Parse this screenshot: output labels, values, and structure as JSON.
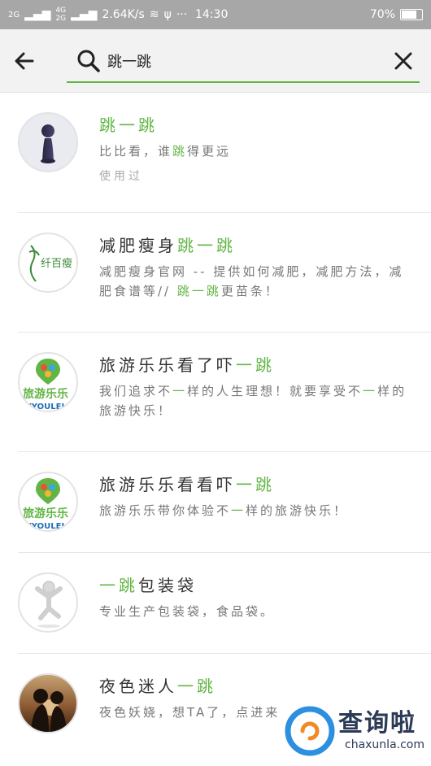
{
  "status_bar": {
    "signal1": "2G",
    "signal2": "4G",
    "signal2b": "2G",
    "speed": "2.64K/s",
    "time": "14:30",
    "battery_percent": "70%"
  },
  "search": {
    "query_prefix": "",
    "query": "跳一跳"
  },
  "results": [
    {
      "title_parts": [
        {
          "t": "跳一跳",
          "hl": true
        }
      ],
      "desc_parts": [
        {
          "t": "比比看，谁",
          "hl": false
        },
        {
          "t": "跳",
          "hl": true
        },
        {
          "t": "得更远",
          "hl": false
        }
      ],
      "meta": "使用过",
      "avatar": "pawn-icon"
    },
    {
      "title_parts": [
        {
          "t": "减肥瘦身",
          "hl": false
        },
        {
          "t": "跳一跳",
          "hl": true
        }
      ],
      "desc_parts": [
        {
          "t": "减肥瘦身官网 -- 提供如何减肥，减肥方法，减肥食谱等// ",
          "hl": false
        },
        {
          "t": "跳一跳",
          "hl": true
        },
        {
          "t": "更苗条！",
          "hl": false
        }
      ],
      "avatar_text": "纤百瘦",
      "avatar": "slim-logo"
    },
    {
      "title_parts": [
        {
          "t": "旅游乐乐看了吓",
          "hl": false
        },
        {
          "t": "一跳",
          "hl": true
        }
      ],
      "desc_parts": [
        {
          "t": "我们追求不",
          "hl": false
        },
        {
          "t": "一",
          "hl": true
        },
        {
          "t": "样的人生理想！就要享受不",
          "hl": false
        },
        {
          "t": "一",
          "hl": true
        },
        {
          "t": "样的旅游快乐！",
          "hl": false
        }
      ],
      "avatar_text": "旅游乐乐",
      "avatar_text2": "LVYOULELE",
      "avatar": "travel-logo"
    },
    {
      "title_parts": [
        {
          "t": "旅游乐乐看看吓",
          "hl": false
        },
        {
          "t": "一跳",
          "hl": true
        }
      ],
      "desc_parts": [
        {
          "t": "旅游乐乐带你体验不",
          "hl": false
        },
        {
          "t": "一",
          "hl": true
        },
        {
          "t": "样的旅游快乐！",
          "hl": false
        }
      ],
      "avatar_text": "旅游乐乐",
      "avatar_text2": "LVYOULELE",
      "avatar": "travel-logo"
    },
    {
      "title_parts": [
        {
          "t": "一跳",
          "hl": true
        },
        {
          "t": "包装袋",
          "hl": false
        }
      ],
      "desc_parts": [
        {
          "t": "专业生产包装袋，食品袋。",
          "hl": false
        }
      ],
      "avatar": "jumping-figure"
    },
    {
      "title_parts": [
        {
          "t": "夜色迷人",
          "hl": false
        },
        {
          "t": "一跳",
          "hl": true
        }
      ],
      "desc_parts": [
        {
          "t": "夜色妖娆，想TA了，点进来",
          "hl": false
        }
      ],
      "avatar": "couple-photo"
    }
  ],
  "watermark": {
    "cn": "查询啦",
    "en": "chaxunla.com"
  },
  "colors": {
    "highlight": "#62b544",
    "status_bar": "#a7a7a7"
  }
}
